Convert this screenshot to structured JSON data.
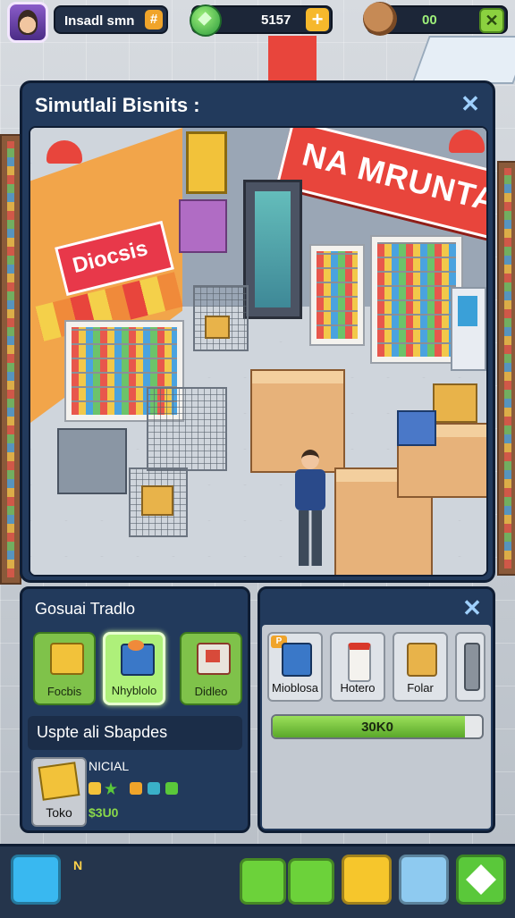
{
  "hud": {
    "player_name": "Insadl smn",
    "name_action_icon": "hash-icon",
    "gems": "5157",
    "gems_icon": "gem-icon",
    "add_label": "+",
    "coins": "00",
    "pet_icon": "hedgehog-icon",
    "close_label": "✕"
  },
  "main_panel": {
    "title": "Simutlali Bisnits :",
    "close_label": "✕",
    "store_sign": "NA MRUNTA",
    "side_sign": "Diocsis"
  },
  "left_panel": {
    "title": "Gosuai Tradlo",
    "cards": [
      {
        "label": "Focbis",
        "icon": "yellow-box-icon",
        "selected": false
      },
      {
        "label": "Nhyblolo",
        "icon": "blue-box-icon",
        "selected": true
      },
      {
        "label": "Didleo",
        "icon": "red-box-icon",
        "selected": false
      }
    ],
    "section_title": "Uspte ali Sbapdes",
    "item": {
      "tile_label": "Toko",
      "name": "NICIAL",
      "price": "$3U0"
    }
  },
  "right_panel": {
    "close_label": "✕",
    "tiles": [
      {
        "label": "Mioblosa",
        "icon": "blue-crate-icon",
        "tag": "P"
      },
      {
        "label": "Hotero",
        "icon": "cup-icon"
      },
      {
        "label": "Folar",
        "icon": "cardboard-box-icon"
      },
      {
        "label": "",
        "icon": "tool-icon"
      }
    ],
    "progress_text": "30K0",
    "progress_fraction": 0.92
  },
  "bottom_bar": {
    "label": "N",
    "buttons": [
      {
        "icon": "tooth-icon"
      },
      {
        "icon": "cash-register-icon"
      },
      {
        "icon": "star-icon"
      },
      {
        "icon": "chat-bubble-icon"
      },
      {
        "icon": "trash-icon"
      },
      {
        "icon": "diamond-icon"
      }
    ]
  },
  "colors": {
    "panel": "#223a5c",
    "accent_green": "#7fc24a",
    "accent_orange": "#f6b82c",
    "sign_red": "#e8453c"
  }
}
